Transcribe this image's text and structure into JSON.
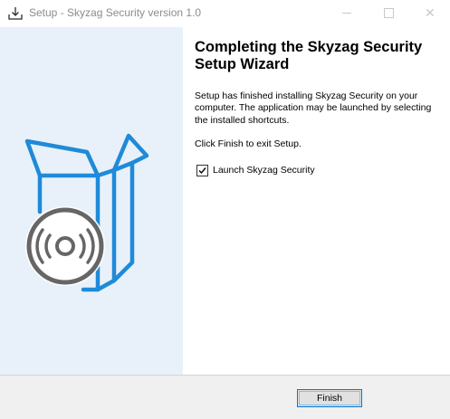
{
  "window": {
    "title": "Setup - Skyzag Security version 1.0",
    "icon": "setup-download-icon",
    "controls": {
      "minimize": "minimize-icon",
      "maximize": "maximize-icon",
      "close": "close-icon",
      "close_glyph": "✕"
    }
  },
  "banner": {
    "art": "software-box-with-disc-icon",
    "colors": {
      "background": "#e8f1f9",
      "box": "#1f8ad8",
      "disc": "#666666"
    }
  },
  "wizard": {
    "heading": "Completing the Skyzag Security Setup Wizard",
    "description": "Setup has finished installing Skyzag Security on your computer. The application may be launched by selecting the installed shortcuts.",
    "exit_text": "Click Finish to exit Setup.",
    "launch_checkbox": {
      "label": "Launch Skyzag Security",
      "checked": true
    }
  },
  "footer": {
    "finish_label": "Finish"
  }
}
